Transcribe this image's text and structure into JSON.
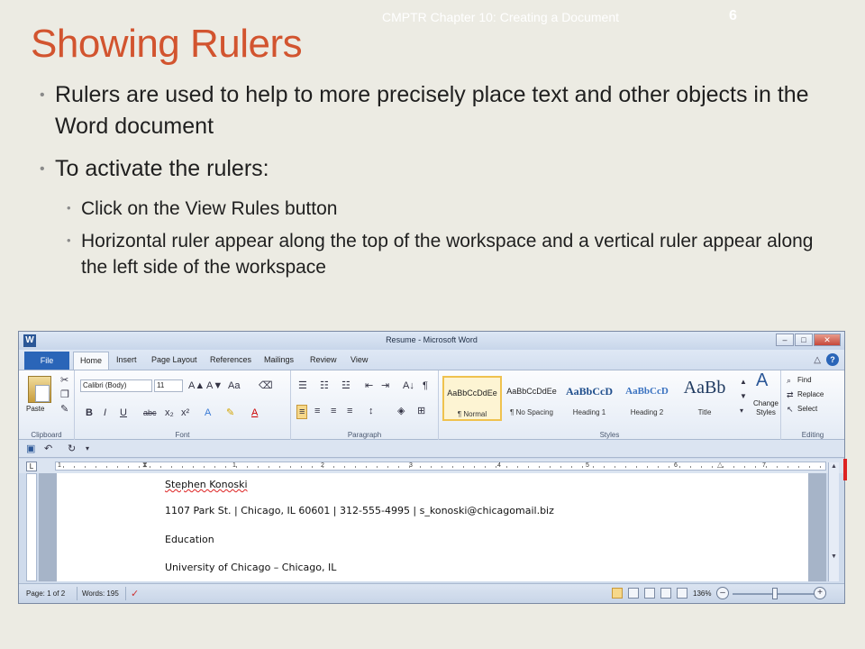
{
  "slide": {
    "header_note": "CMPTR Chapter 10: Creating a Document",
    "page_number": "6",
    "title": "Showing Rulers",
    "bullets": [
      "Rulers are used to help to more precisely place text and other objects in the Word document",
      "To activate the rulers:"
    ],
    "sub_bullets": [
      "Click on the View Rules button",
      "Horizontal ruler appear along the top of the workspace and a vertical ruler appear along the left side of the workspace"
    ],
    "bullet_glyph": "•"
  },
  "word": {
    "window_title": "Resume - Microsoft Word",
    "app_icon": "W",
    "window_controls": {
      "minimize": "–",
      "maximize": "□",
      "close": "✕"
    },
    "tabs": [
      "File",
      "Home",
      "Insert",
      "Page Layout",
      "References",
      "Mailings",
      "Review",
      "View"
    ],
    "active_tab": "Home",
    "help_icon": "?",
    "minimize_ribbon_icon": "△",
    "ribbon": {
      "clipboard": {
        "label": "Clipboard",
        "paste": "Paste",
        "cut_icon": "✂",
        "copy_icon": "❐",
        "format_painter_icon": "✎"
      },
      "font": {
        "label": "Font",
        "font_name": "Calibri (Body)",
        "font_size": "11",
        "grow_icon": "A▲",
        "shrink_icon": "A▼",
        "case_icon": "Aa",
        "clear_icon": "⌫",
        "bold": "B",
        "italic": "I",
        "underline": "U",
        "strike": "abc",
        "subscript": "x₂",
        "superscript": "x²",
        "effects_icon": "A",
        "highlight_icon": "✎",
        "color_icon": "A"
      },
      "paragraph": {
        "label": "Paragraph",
        "bullets_icon": "☰",
        "numbering_icon": "☷",
        "multilevel_icon": "☳",
        "decrease_indent_icon": "⇤",
        "increase_indent_icon": "⇥",
        "sort_icon": "A↓",
        "pilcrow_icon": "¶",
        "align_left_icon": "≡",
        "align_center_icon": "≡",
        "align_right_icon": "≡",
        "justify_icon": "≡",
        "line_spacing_icon": "↕",
        "shading_icon": "◈",
        "borders_icon": "⊞"
      },
      "styles": {
        "label": "Styles",
        "items": [
          {
            "sample": "AaBbCcDdEe",
            "name": "¶ Normal",
            "selected": true
          },
          {
            "sample": "AaBbCcDdEe",
            "name": "¶ No Spacing",
            "selected": false
          },
          {
            "sample": "AaBbCcD",
            "name": "Heading 1",
            "selected": false
          },
          {
            "sample": "AaBbCcD",
            "name": "Heading 2",
            "selected": false
          },
          {
            "sample": "AaBb",
            "name": "Title",
            "selected": false
          }
        ],
        "change_styles": "Change Styles"
      },
      "editing": {
        "label": "Editing",
        "find": "Find",
        "replace": "Replace",
        "select": "Select"
      }
    },
    "ruler": {
      "tab_selector": "L",
      "numbers": [
        "1",
        "1",
        "2",
        "3",
        "4",
        "5",
        "6",
        "7"
      ]
    },
    "document": {
      "lines": [
        "Stephen Konoski",
        "1107 Park St.  |  Chicago, IL 60601  |  312-555-4995  |  s_konoski@chicagomail.biz",
        "Education",
        "University of Chicago – Chicago, IL"
      ]
    },
    "status": {
      "page": "Page: 1 of 2",
      "words": "Words: 195",
      "zoom": "136%",
      "zoom_out": "–",
      "zoom_in": "+"
    }
  }
}
